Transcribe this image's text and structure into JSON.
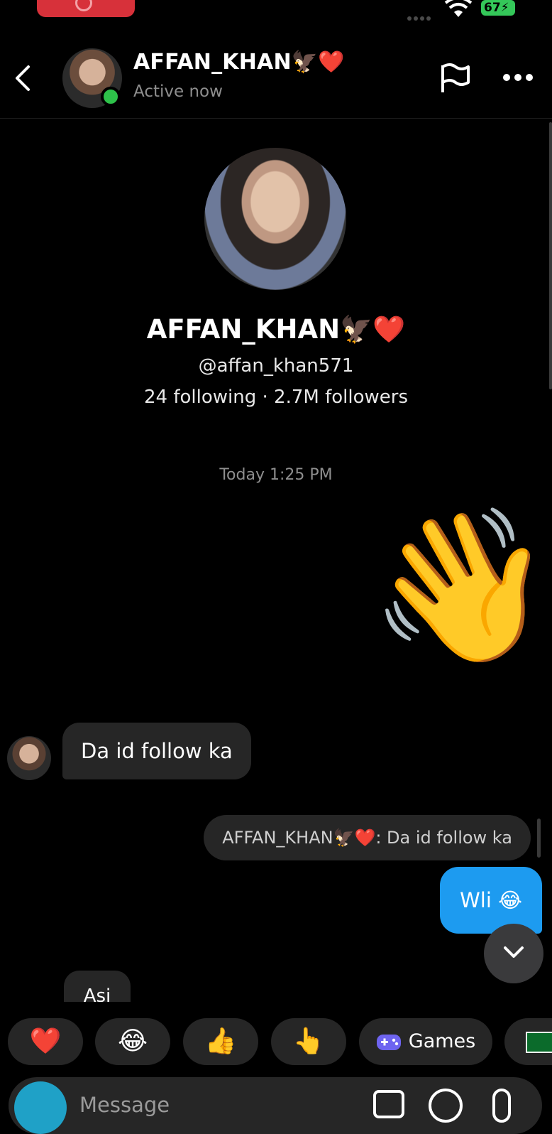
{
  "status_bar": {
    "battery": "67"
  },
  "header": {
    "name": "AFFAN_KHAN🦅❤️",
    "status": "Active now"
  },
  "profile": {
    "name": "AFFAN_KHAN🦅❤️",
    "handle": "@affan_khan571",
    "stats": "24 following · 2.7M followers"
  },
  "chat": {
    "timestamp": "Today 1:25 PM",
    "wave_emoji": "👋",
    "incoming_1": "Da id follow ka",
    "reply_quote": "AFFAN_KHAN🦅❤️: Da id follow ka",
    "outgoing_1": "Wli 😂",
    "incoming_2_partial": "Asi"
  },
  "quick_reactions": {
    "heart": "❤️",
    "laugh": "😂",
    "thumbs_up": "👍",
    "pointing": "👆",
    "games_label": "Games"
  },
  "input": {
    "placeholder": "Message"
  },
  "colors": {
    "accent_blue": "#1d9bf0",
    "active_green": "#2ec24a",
    "bubble_gray": "#262626",
    "record_red": "#d7313a"
  }
}
